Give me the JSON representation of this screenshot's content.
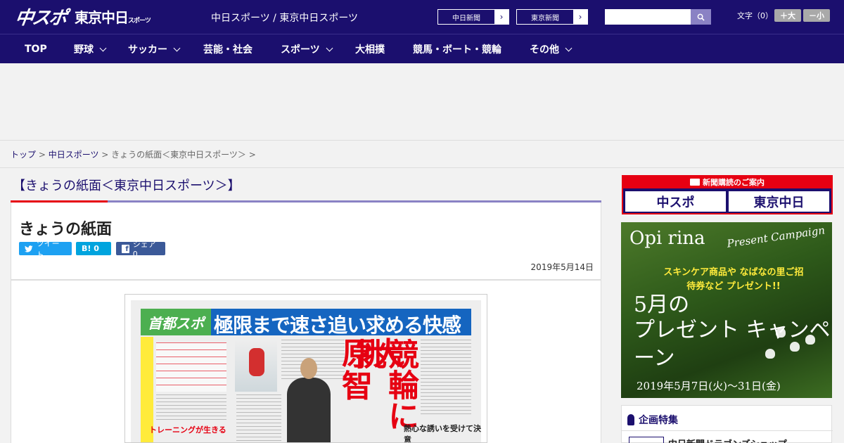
{
  "header": {
    "logo_main": "中スポ",
    "logo_tokyo": "東京中日",
    "logo_tokyo_small": "スポーツ",
    "tagline": "中日スポーツ / 東京中日スポーツ",
    "links": [
      {
        "label": "中日新聞"
      },
      {
        "label": "東京新聞"
      }
    ],
    "search_placeholder": "",
    "font_label": "文字（0）",
    "font_plus": "＋大",
    "font_minus": "－小"
  },
  "nav": {
    "items": [
      {
        "label": "TOP",
        "dropdown": false
      },
      {
        "label": "野球",
        "dropdown": true
      },
      {
        "label": "サッカー",
        "dropdown": true
      },
      {
        "label": "芸能・社会",
        "dropdown": false
      },
      {
        "label": "スポーツ",
        "dropdown": true
      },
      {
        "label": "大相撲",
        "dropdown": false
      },
      {
        "label": "競馬・ボート・競輪",
        "dropdown": false
      },
      {
        "label": "その他",
        "dropdown": true
      }
    ]
  },
  "breadcrumb": {
    "top": "トップ",
    "sep1": " > ",
    "chunichi": "中日スポーツ",
    "sep2": " > ",
    "current": "きょうの紙面＜東京中日スポーツ＞ >"
  },
  "article": {
    "section_title": "【きょうの紙面＜東京中日スポーツ＞】",
    "title": "きょうの紙面",
    "share_tweet": "ツイート",
    "share_hatena": "B! 0",
    "share_facebook": "シェア 0",
    "date": "2019年5月14日"
  },
  "paper": {
    "brand": "首都スポ",
    "headline": "極限まで速さ追い求める快感",
    "big1": "競輪に挑",
    "big2": "原大智",
    "sub1": "トレーニングが生きる",
    "sub2": "熱心な誘いを受けて決意"
  },
  "sidebar": {
    "subscribe_head": "新聞購読のご案内",
    "subscribe_chuspo": "中スポ",
    "subscribe_tokyo": "東京中日",
    "promo_brand": "Opi rina",
    "promo_campaign": "Present Campaign",
    "promo_sub": "スキンケア商品や なばなの里ご招待券など プレゼント!!",
    "promo_month": "5月の",
    "promo_present": "プレゼント キャンペーン",
    "promo_dates": "2019年5月7日(火)〜31日(金)",
    "feature_head": "企画特集",
    "feature_item": "中日新聞ドラゴンズショップ"
  },
  "colors": {
    "brand_navy": "#1b0f6e",
    "accent_red": "#e60012",
    "twitter": "#1da1f2",
    "hatena": "#00a4de",
    "facebook": "#3b5998"
  }
}
